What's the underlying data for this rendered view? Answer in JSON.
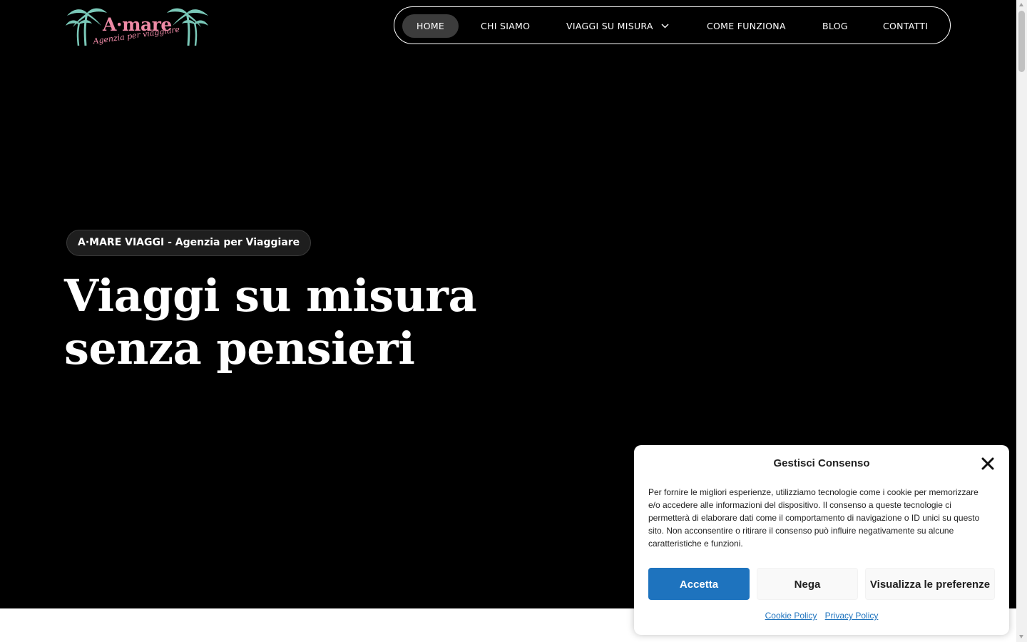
{
  "logo": {
    "name": "A·mare",
    "tagline": "Agenzia per viaggiare",
    "palm_color": "#7ac8b8",
    "text_color": "#ee8aa6"
  },
  "nav": {
    "items": [
      {
        "label": "HOME",
        "active": true
      },
      {
        "label": "CHI SIAMO"
      },
      {
        "label": "VIAGGI SU MISURA",
        "icon": "chevron-down-icon"
      },
      {
        "label": "COME FUNZIONA"
      },
      {
        "label": "BLOG"
      },
      {
        "label": "CONTATTI"
      }
    ]
  },
  "hero": {
    "badge": "A·MARE VIAGGI - Agenzia per Viaggiare",
    "headline_line1": "Viaggi su misura",
    "headline_line2": "senza pensieri",
    "background": "#000000"
  },
  "consent": {
    "title": "Gestisci Consenso",
    "close_icon": "close-icon",
    "text": "Per fornire le migliori esperienze, utilizziamo tecnologie come i cookie per memorizzare e/o accedere alle informazioni del dispositivo. Il consenso a queste tecnologie ci permetterà di elaborare dati come il comportamento di navigazione o ID unici su questo sito. Non acconsentire o ritirare il consenso può influire negativamente su alcune caratteristiche e funzioni.",
    "accept_label": "Accetta",
    "deny_label": "Nega",
    "prefs_label": "Visualizza le preferenze",
    "cookie_policy_label": "Cookie Policy",
    "privacy_policy_label": "Privacy Policy",
    "accent": "#1e73be"
  }
}
